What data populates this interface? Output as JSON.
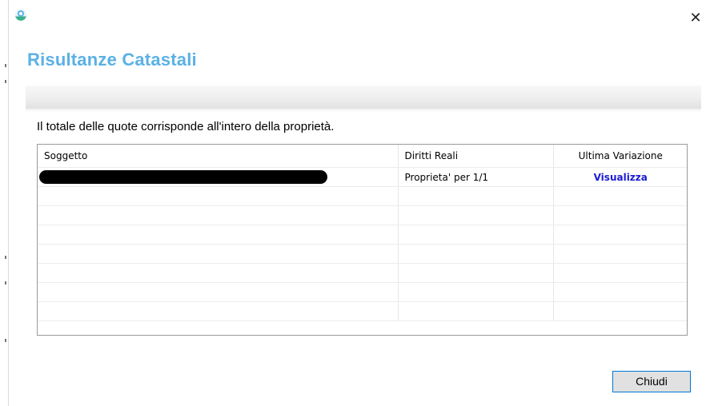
{
  "window": {
    "close_glyph": "✕"
  },
  "header": {
    "title": "Risultanze Catastali"
  },
  "message": "Il totale delle quote corrisponde all'intero della proprietà.",
  "grid": {
    "columns": [
      "Soggetto",
      "Diritti Reali",
      "Ultima Variazione"
    ],
    "rows": [
      {
        "soggetto": "",
        "diritti_reali": "Proprieta' per 1/1",
        "ultima_variazione": "Visualizza"
      }
    ],
    "empty_rows": 7
  },
  "footer": {
    "close_label": "Chiudi"
  },
  "colors": {
    "title": "#5ab1e6",
    "link": "#1a1ad6",
    "button_border": "#0078d7"
  },
  "icons": {
    "app": "app-logo-icon",
    "close": "close-icon"
  }
}
